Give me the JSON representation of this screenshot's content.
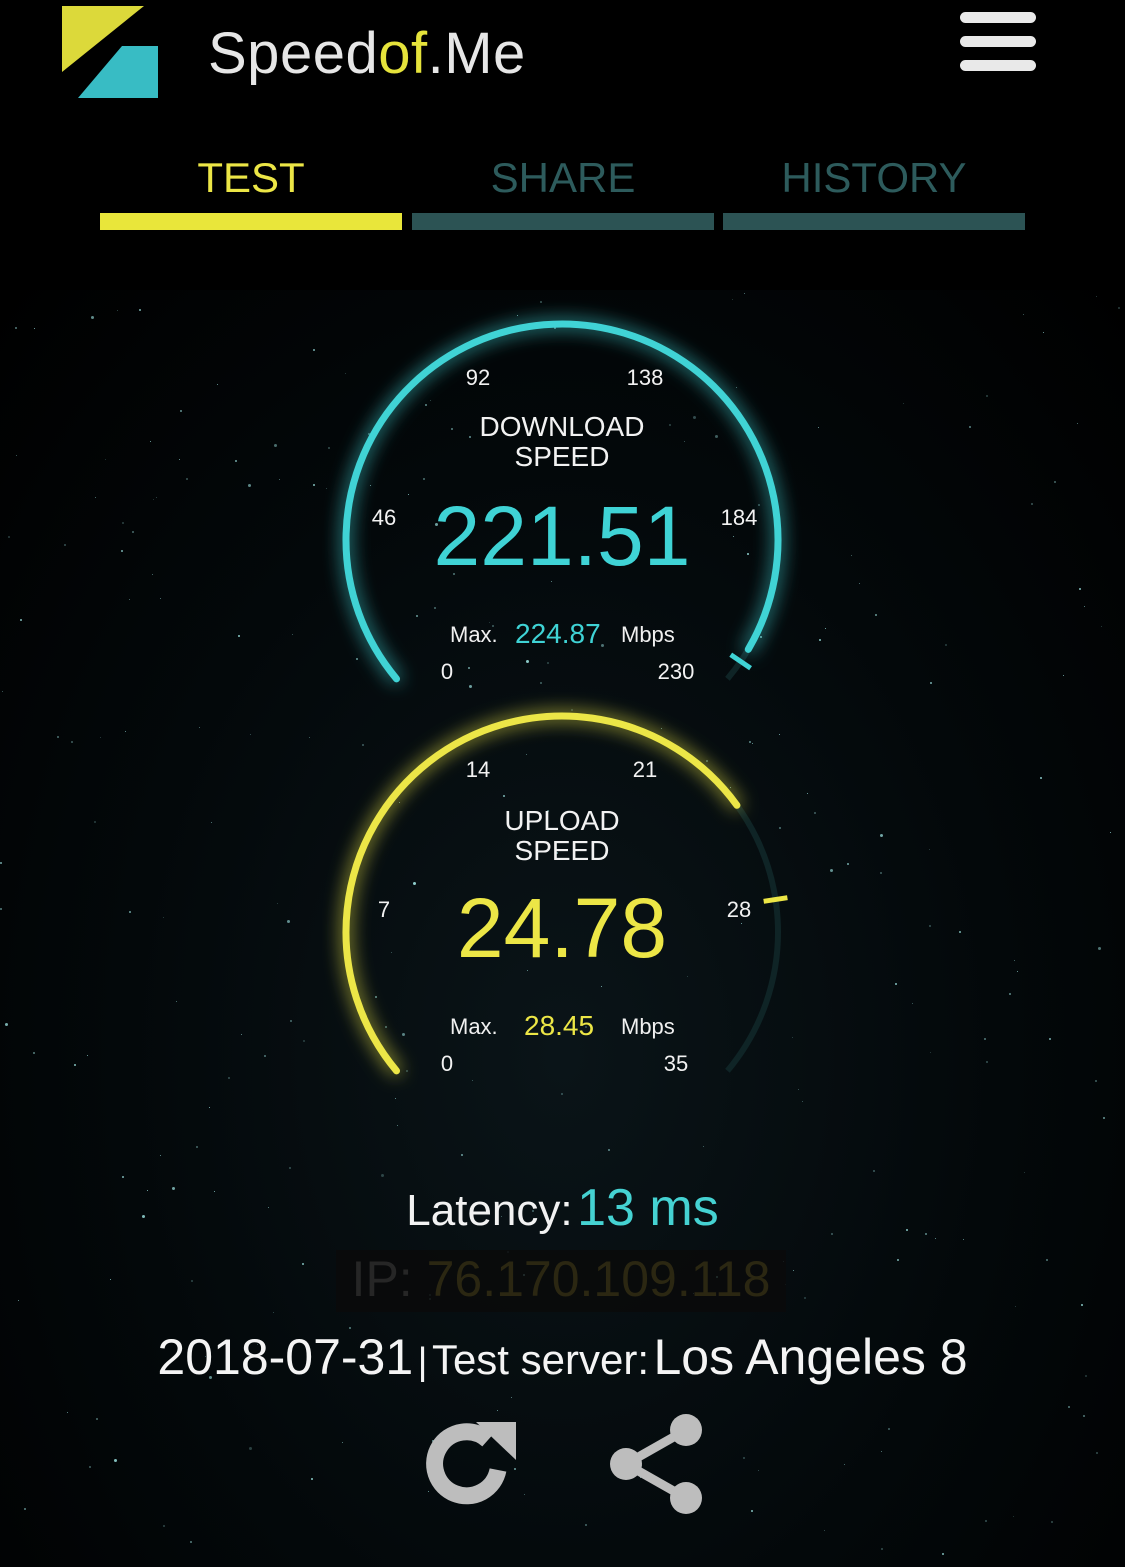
{
  "header": {
    "brand_prefix": "Speed",
    "brand_accent": "of",
    "brand_suffix": ".Me",
    "menu_icon": "hamburger-menu-icon"
  },
  "tabs": [
    {
      "label": "TEST",
      "active": true
    },
    {
      "label": "SHARE",
      "active": false
    },
    {
      "label": "HISTORY",
      "active": false
    }
  ],
  "download": {
    "title_line1": "DOWNLOAD",
    "title_line2": "SPEED",
    "value": "221.51",
    "max_label": "Max.",
    "max_value": "224.87",
    "unit": "Mbps",
    "ticks": [
      "0",
      "46",
      "92",
      "138",
      "184",
      "230"
    ],
    "scale_max": 230,
    "color": "#3fd3d5"
  },
  "upload": {
    "title_line1": "UPLOAD",
    "title_line2": "SPEED",
    "value": "24.78",
    "max_label": "Max.",
    "max_value": "28.45",
    "unit": "Mbps",
    "ticks": [
      "0",
      "7",
      "14",
      "21",
      "28",
      "35"
    ],
    "scale_max": 35,
    "color": "#ece646"
  },
  "latency": {
    "label": "Latency:",
    "value": "13 ms"
  },
  "ip": {
    "label": "IP:",
    "value": "76.170.109.118"
  },
  "info": {
    "date": "2018-07-31",
    "separator": "|",
    "server_label": "Test server:",
    "server_value": "Los Angeles 8"
  },
  "actions": {
    "restart_icon": "restart-icon",
    "share_icon": "share-icon"
  }
}
